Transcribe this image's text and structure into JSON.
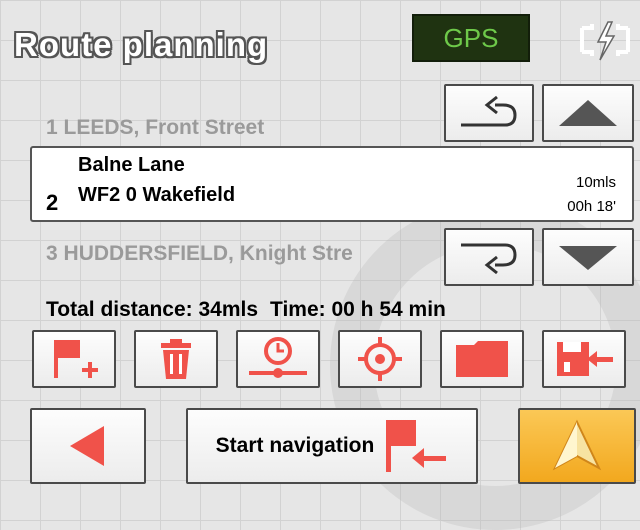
{
  "header": {
    "title": "Route planning",
    "gps_label": "GPS"
  },
  "route": {
    "stops": [
      {
        "index": "1",
        "text": "LEEDS, Front Street"
      },
      {
        "index": "2",
        "line1": "Balne Lane",
        "line2": "WF2 0 Wakefield",
        "distance": "10mls",
        "time": "00h 18'"
      },
      {
        "index": "3",
        "text": "HUDDERSFIELD, Knight Stre"
      }
    ]
  },
  "summary": {
    "total_distance": "Total distance: 34mls",
    "time": "Time: 00 h 54 min"
  },
  "bottom": {
    "start_label": "Start navigation"
  },
  "colors": {
    "accent_red": "#f0524a",
    "gps_bg": "#1f3311",
    "gps_text": "#6ec94a",
    "nav_orange": "#f7b733"
  },
  "icons": [
    "power-plug-icon",
    "return-left-icon",
    "up-arrow-icon",
    "return-right-icon",
    "down-arrow-icon",
    "flag-add-icon",
    "trash-icon",
    "route-time-icon",
    "crosshair-icon",
    "folder-icon",
    "save-route-icon",
    "back-arrow-icon",
    "flag-arrow-icon",
    "navigation-arrow-icon"
  ]
}
